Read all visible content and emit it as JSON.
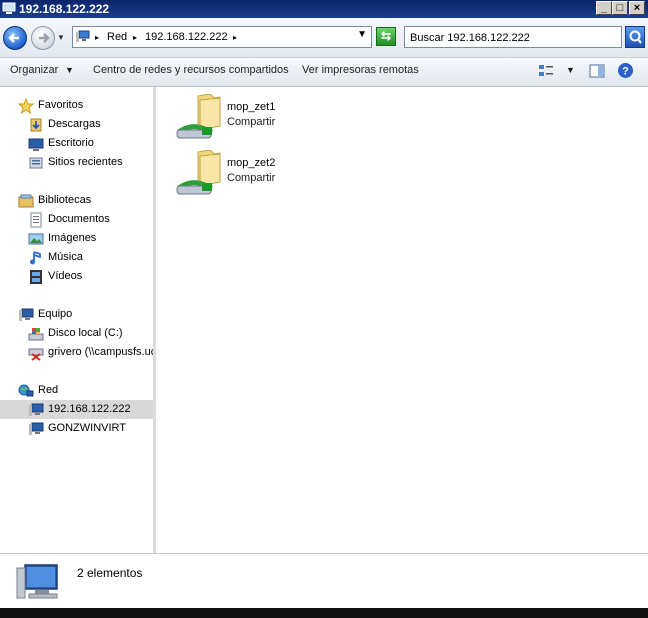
{
  "window": {
    "title": "192.168.122.222"
  },
  "address": {
    "crumbs": [
      "Red",
      "192.168.122.222"
    ],
    "search_placeholder": "Buscar 192.168.122.222"
  },
  "toolbar": {
    "organize": "Organizar",
    "network_center": "Centro de redes y recursos compartidos",
    "view_printers": "Ver impresoras remotas"
  },
  "nav": {
    "favorites": {
      "label": "Favoritos",
      "items": [
        "Descargas",
        "Escritorio",
        "Sitios recientes"
      ]
    },
    "libraries": {
      "label": "Bibliotecas",
      "items": [
        "Documentos",
        "Imágenes",
        "Música",
        "Vídeos"
      ]
    },
    "computer": {
      "label": "Equipo",
      "items": [
        "Disco local (C:)",
        "grivero (\\\\campusfs.uc"
      ]
    },
    "network": {
      "label": "Red",
      "items": [
        "192.168.122.222",
        "GONZWINVIRT"
      ],
      "selected": "192.168.122.222"
    }
  },
  "shares": [
    {
      "name": "mop_zet1",
      "type": "Compartir"
    },
    {
      "name": "mop_zet2",
      "type": "Compartir"
    }
  ],
  "details": {
    "count": "2 elementos"
  },
  "colors": {
    "titlebar": "#0a246a",
    "selection": "#d9d9d9"
  }
}
